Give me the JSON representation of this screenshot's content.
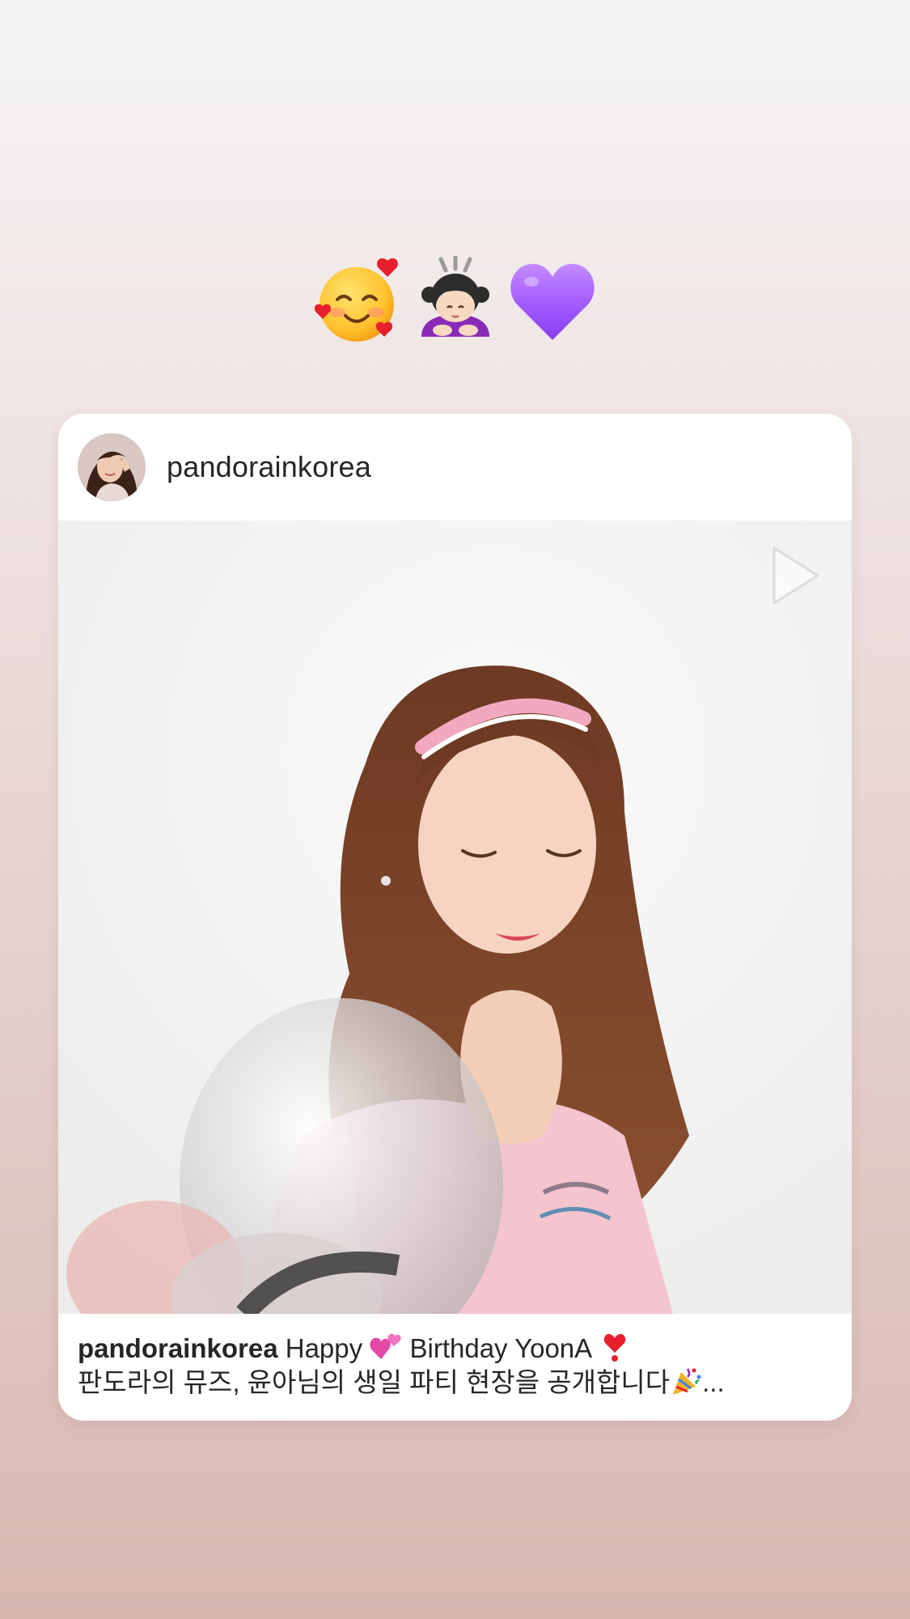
{
  "story": {
    "stickers": [
      "smiling-face-with-hearts",
      "person-bowing",
      "purple-heart"
    ]
  },
  "post": {
    "username": "pandorainkorea",
    "media_type": "video",
    "caption": {
      "username": "pandorainkorea",
      "part1": "Happy",
      "part2": "Birthday YoonA",
      "line2": "판도라의 뮤즈, 윤아님의 생일 파티 현장을 공개합니다",
      "ellipsis": "..."
    }
  },
  "colors": {
    "background_top": "#f6f5f5",
    "background_bottom": "#d8b8b1",
    "card": "#ffffff",
    "text": "#262626",
    "purple_heart": "#a259ff"
  }
}
